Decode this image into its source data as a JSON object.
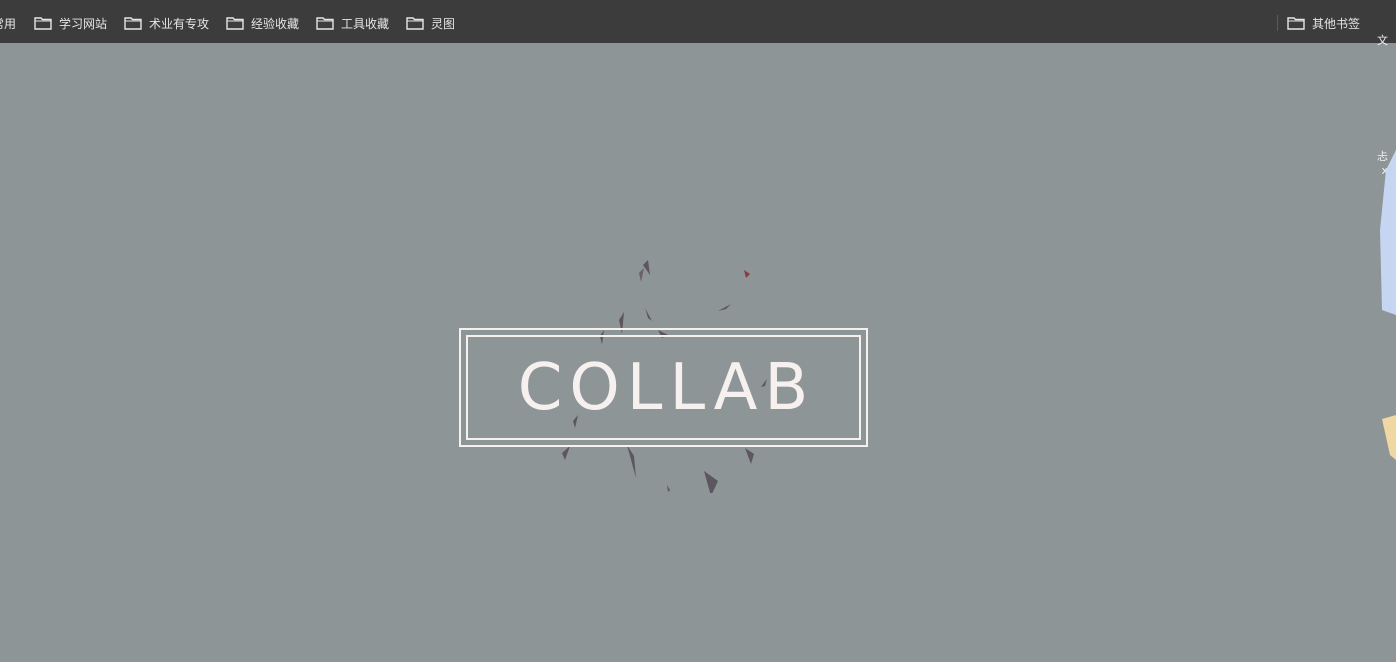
{
  "bookmarks_bar": {
    "items": [
      {
        "label": "常用",
        "icon": "folder-icon"
      },
      {
        "label": "学习网站",
        "icon": "folder-icon"
      },
      {
        "label": "术业有专攻",
        "icon": "folder-icon"
      },
      {
        "label": "经验收藏",
        "icon": "folder-icon"
      },
      {
        "label": "工具收藏",
        "icon": "folder-icon"
      },
      {
        "label": "灵图",
        "icon": "folder-icon"
      }
    ],
    "other_bookmarks": {
      "label": "其他书签",
      "icon": "folder-icon"
    }
  },
  "logo": {
    "text": "COLLAB"
  },
  "side_panel": {
    "glyph_top": "文",
    "glyph_mid": "忐",
    "close_glyph": "x"
  },
  "colors": {
    "background": "#8d9597",
    "bar": "#3c3c3c",
    "logo": "#f4f1ef",
    "shard_dark": "#5d5560",
    "shard_red": "#8a3a45"
  }
}
